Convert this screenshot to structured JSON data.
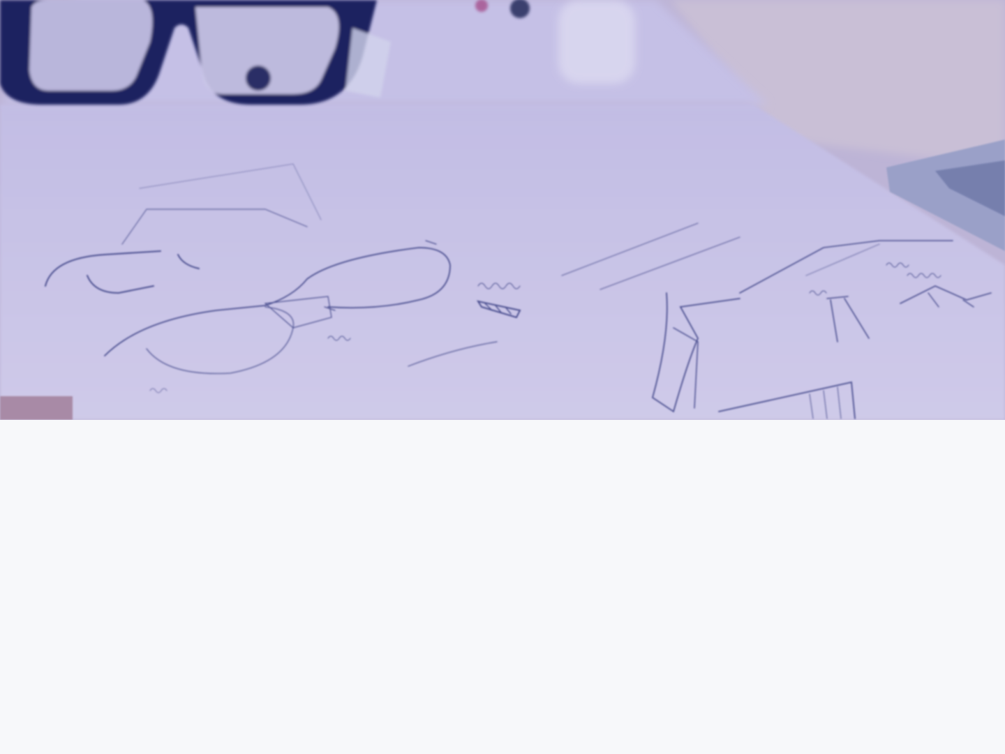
{
  "hero": {
    "image": "glasses-sketch-photo",
    "overlay_color": "#b7b2de",
    "paper_color": "#cbc6e7",
    "ink_color": "#4a4f8a",
    "glasses_frame_color": "#1f2a6b"
  },
  "page": {
    "background_color": "#f7f8fa"
  }
}
